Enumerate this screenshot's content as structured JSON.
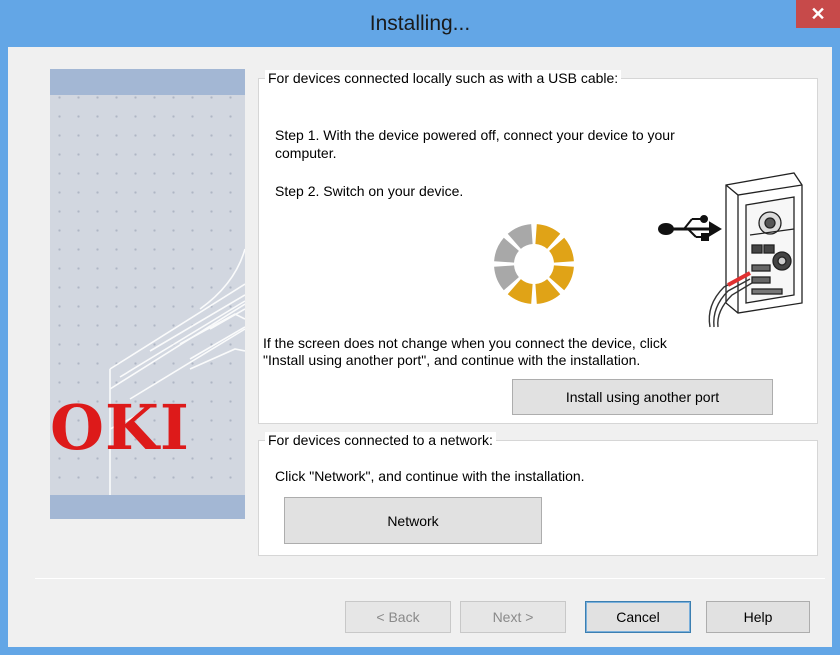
{
  "window": {
    "title": "Installing...",
    "close_glyph": "✕"
  },
  "banner": {
    "logo_text": "OKI",
    "logo_color": "#dd1a1a"
  },
  "usb_group": {
    "legend": "For devices connected locally such as with a USB cable:",
    "step1_line1": "Step 1. With the device powered off, connect your device to your",
    "step1_line2": "computer.",
    "step2": "Step 2. Switch on your device.",
    "note_line1": "If the screen does not change when you connect the device, click",
    "note_line2": "\"Install using another port\", and continue with the installation.",
    "install_button": "Install using another port",
    "spinner_icon": "loading-spinner-icon",
    "illustration_icon": "usb-computer-icon"
  },
  "network_group": {
    "legend": "For devices connected to a network:",
    "instruction": "Click \"Network\", and continue with the installation.",
    "network_button": "Network"
  },
  "footer": {
    "back_button": "< Back",
    "next_button": "Next >",
    "cancel_button": "Cancel",
    "help_button": "Help"
  },
  "colors": {
    "titlebar": "#63a6e6",
    "close_button": "#c74a4a",
    "spinner_active": "#e0a317",
    "spinner_inactive": "#a8a8a8"
  }
}
